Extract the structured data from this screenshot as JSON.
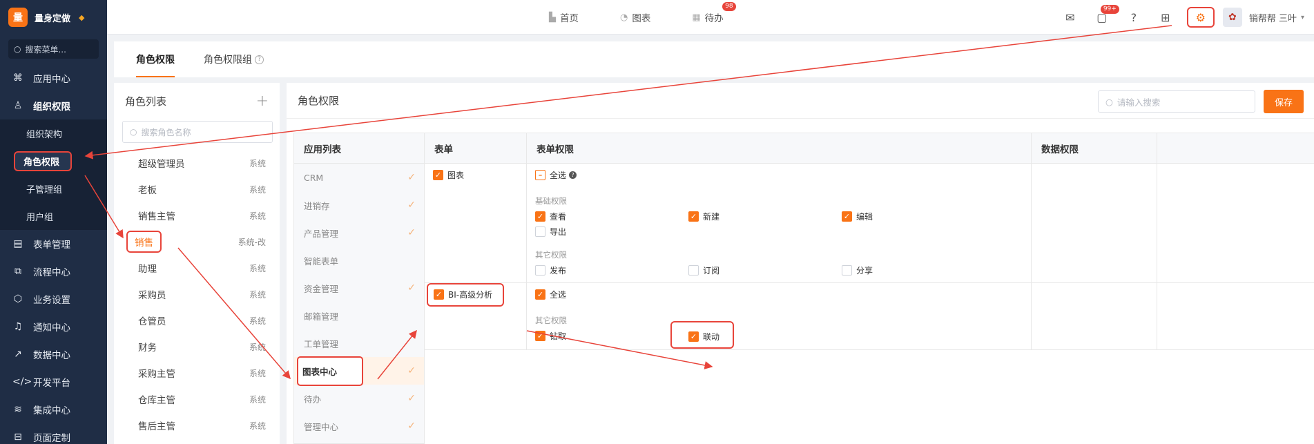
{
  "brand": {
    "name": "量身定做",
    "logo_char": "量"
  },
  "sidebar": {
    "search_placeholder": "搜索菜单...",
    "items_top": [
      {
        "label": "应用中心",
        "icon": "grid-icon"
      },
      {
        "label": "组织权限",
        "icon": "user-icon"
      }
    ],
    "sub_items": [
      {
        "label": "组织架构"
      },
      {
        "label": "角色权限"
      },
      {
        "label": "子管理组"
      },
      {
        "label": "用户组"
      }
    ],
    "items_bottom": [
      {
        "label": "表单管理",
        "icon": "form-icon"
      },
      {
        "label": "流程中心",
        "icon": "flow-icon"
      },
      {
        "label": "业务设置",
        "icon": "box-icon"
      },
      {
        "label": "通知中心",
        "icon": "bell-icon"
      },
      {
        "label": "数据中心",
        "icon": "chart-icon"
      },
      {
        "label": "开发平台",
        "icon": "code-icon"
      },
      {
        "label": "集成中心",
        "icon": "layers-icon"
      },
      {
        "label": "页面定制",
        "icon": "page-icon"
      }
    ]
  },
  "topbar": {
    "nav": [
      {
        "label": "首页",
        "icon": "home-icon"
      },
      {
        "label": "图表",
        "icon": "pie-icon"
      },
      {
        "label": "待办",
        "icon": "calendar-icon",
        "badge": "98"
      }
    ],
    "message_badge": "99+",
    "username": "销帮帮 三叶"
  },
  "tabs": [
    {
      "label": "角色权限"
    },
    {
      "label": "角色权限组"
    }
  ],
  "roles": {
    "title": "角色列表",
    "search_placeholder": "搜索角色名称",
    "items": [
      {
        "name": "超级管理员",
        "tag": "系统"
      },
      {
        "name": "老板",
        "tag": "系统"
      },
      {
        "name": "销售主管",
        "tag": "系统"
      },
      {
        "name": "销售",
        "tag": "系统-改"
      },
      {
        "name": "助理",
        "tag": "系统"
      },
      {
        "name": "采购员",
        "tag": "系统"
      },
      {
        "name": "仓管员",
        "tag": "系统"
      },
      {
        "name": "财务",
        "tag": "系统"
      },
      {
        "name": "采购主管",
        "tag": "系统"
      },
      {
        "name": "仓库主管",
        "tag": "系统"
      },
      {
        "name": "售后主管",
        "tag": "系统"
      }
    ]
  },
  "main": {
    "title": "角色权限",
    "search_placeholder": "请输入搜索",
    "save_label": "保存",
    "applist_header": "应用列表",
    "apps": [
      {
        "name": "CRM",
        "checked": true
      },
      {
        "name": "进销存",
        "checked": true
      },
      {
        "name": "产品管理",
        "checked": true
      },
      {
        "name": "智能表单",
        "checked": false
      },
      {
        "name": "资金管理",
        "checked": true
      },
      {
        "name": "邮箱管理",
        "checked": false
      },
      {
        "name": "工单管理",
        "checked": false
      },
      {
        "name": "图表中心",
        "checked": true
      },
      {
        "name": "待办",
        "checked": true
      },
      {
        "name": "管理中心",
        "checked": true
      }
    ],
    "headers": {
      "form": "表单",
      "form_perm": "表单权限",
      "data_perm": "数据权限"
    },
    "rows": [
      {
        "form": "图表",
        "select_all": "全选",
        "basic_label": "基础权限",
        "basic": [
          {
            "label": "查看",
            "checked": true
          },
          {
            "label": "新建",
            "checked": true
          },
          {
            "label": "编辑",
            "checked": true
          },
          {
            "label": "导出",
            "checked": false
          }
        ],
        "other_label": "其它权限",
        "other": [
          {
            "label": "发布",
            "checked": false
          },
          {
            "label": "订阅",
            "checked": false
          },
          {
            "label": "分享",
            "checked": false
          }
        ]
      },
      {
        "form": "BI-高级分析",
        "select_all": "全选",
        "other_label": "其它权限",
        "other": [
          {
            "label": "钻取",
            "checked": true
          },
          {
            "label": "联动",
            "checked": true
          }
        ]
      }
    ]
  },
  "colors": {
    "accent": "#f97316",
    "sidebar_bg": "#1f2d45",
    "annotation": "#e8443a"
  }
}
